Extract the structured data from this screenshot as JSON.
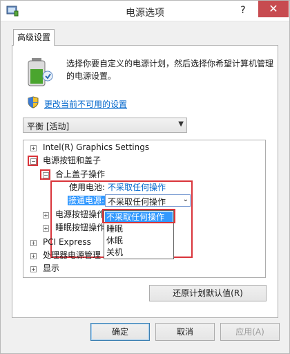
{
  "window": {
    "title": "电源选项",
    "help": "?",
    "close": "✕"
  },
  "tab": {
    "label": "高级设置"
  },
  "description": "选择你要自定义的电源计划，然后选择你希望计算机管理的电源设置。",
  "change_link": "更改当前不可用的设置",
  "plan_select": {
    "value": "平衡 [活动]"
  },
  "tree": {
    "intel": "Intel(R) Graphics Settings",
    "power_buttons_lid": "电源按钮和盖子",
    "lid_close_action": "合上盖子操作",
    "on_battery_label": "使用电池:",
    "on_battery_value": "不采取任何操作",
    "plugged_in_label": "接通电源:",
    "plugged_in_value": "不采取任何操作",
    "power_button_action": "电源按钮操作",
    "sleep_button_action": "睡眠按钮操作",
    "pci_express": "PCI Express",
    "processor_power": "处理器电源管理",
    "display": "显示"
  },
  "dropdown_options": [
    "不采取任何操作",
    "睡眠",
    "休眠",
    "关机"
  ],
  "restore_button": "还原计划默认值(R)",
  "buttons": {
    "ok": "确定",
    "cancel": "取消",
    "apply": "应用(A)"
  },
  "colors": {
    "accent": "#3399ff",
    "highlight_red": "#d9343a",
    "link": "#0066cc",
    "close_red": "#c74b50"
  }
}
